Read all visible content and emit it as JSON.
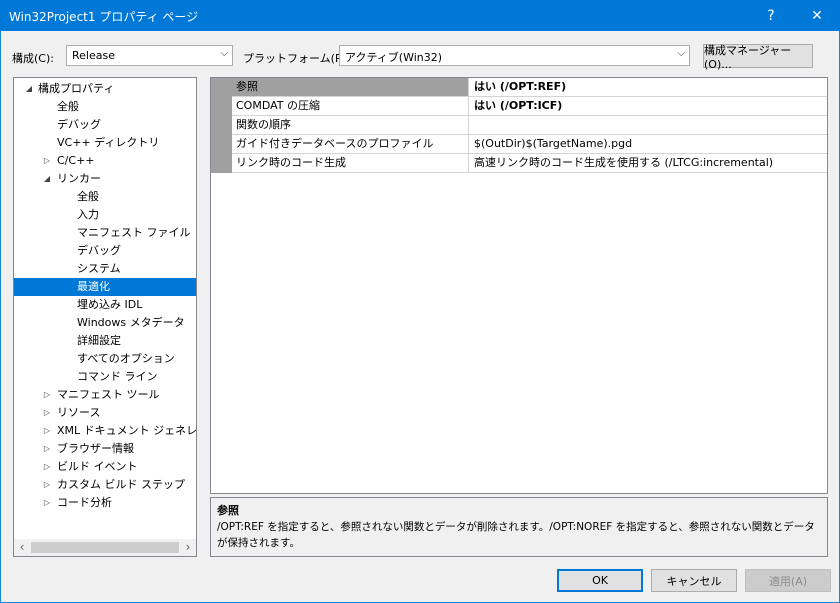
{
  "window": {
    "title": "Win32Project1 プロパティ ページ",
    "help_label": "?",
    "close_label": "✕"
  },
  "toolbar": {
    "config_label": "構成(C):",
    "config_value": "Release",
    "platform_label": "プラットフォーム(P):",
    "platform_value": "アクティブ(Win32)",
    "config_manager_label": "構成マネージャー(O)..."
  },
  "tree": {
    "items": [
      {
        "label": "構成プロパティ",
        "expander": "◢"
      },
      {
        "label": "全般"
      },
      {
        "label": "デバッグ"
      },
      {
        "label": "VC++ ディレクトリ"
      },
      {
        "label": "C/C++",
        "expander": "▷"
      },
      {
        "label": "リンカー",
        "expander": "◢"
      },
      {
        "label": "全般"
      },
      {
        "label": "入力"
      },
      {
        "label": "マニフェスト ファイル"
      },
      {
        "label": "デバッグ"
      },
      {
        "label": "システム"
      },
      {
        "label": "最適化"
      },
      {
        "label": "埋め込み IDL"
      },
      {
        "label": "Windows メタデータ"
      },
      {
        "label": "詳細設定"
      },
      {
        "label": "すべてのオプション"
      },
      {
        "label": "コマンド ライン"
      },
      {
        "label": "マニフェスト ツール",
        "expander": "▷"
      },
      {
        "label": "リソース",
        "expander": "▷"
      },
      {
        "label": "XML ドキュメント ジェネレーター",
        "expander": "▷"
      },
      {
        "label": "ブラウザー情報",
        "expander": "▷"
      },
      {
        "label": "ビルド イベント",
        "expander": "▷"
      },
      {
        "label": "カスタム ビルド ステップ",
        "expander": "▷"
      },
      {
        "label": "コード分析",
        "expander": "▷"
      }
    ],
    "scroll_left": "‹",
    "scroll_right": "›"
  },
  "properties": {
    "rows": [
      {
        "name": "参照",
        "value": "はい (/OPT:REF)"
      },
      {
        "name": "COMDAT の圧縮",
        "value": "はい (/OPT:ICF)"
      },
      {
        "name": "関数の順序",
        "value": ""
      },
      {
        "name": "ガイド付きデータベースのプロファイル",
        "value": "$(OutDir)$(TargetName).pgd"
      },
      {
        "name": "リンク時のコード生成",
        "value": "高速リンク時のコード生成を使用する (/LTCG:incremental)"
      }
    ]
  },
  "description": {
    "title": "参照",
    "text": "/OPT:REF を指定すると、参照されない関数とデータが削除されます。/OPT:NOREF を指定すると、参照されない関数とデータが保持されます。"
  },
  "buttons": {
    "ok": "OK",
    "cancel": "キャンセル",
    "apply": "適用(A)"
  }
}
